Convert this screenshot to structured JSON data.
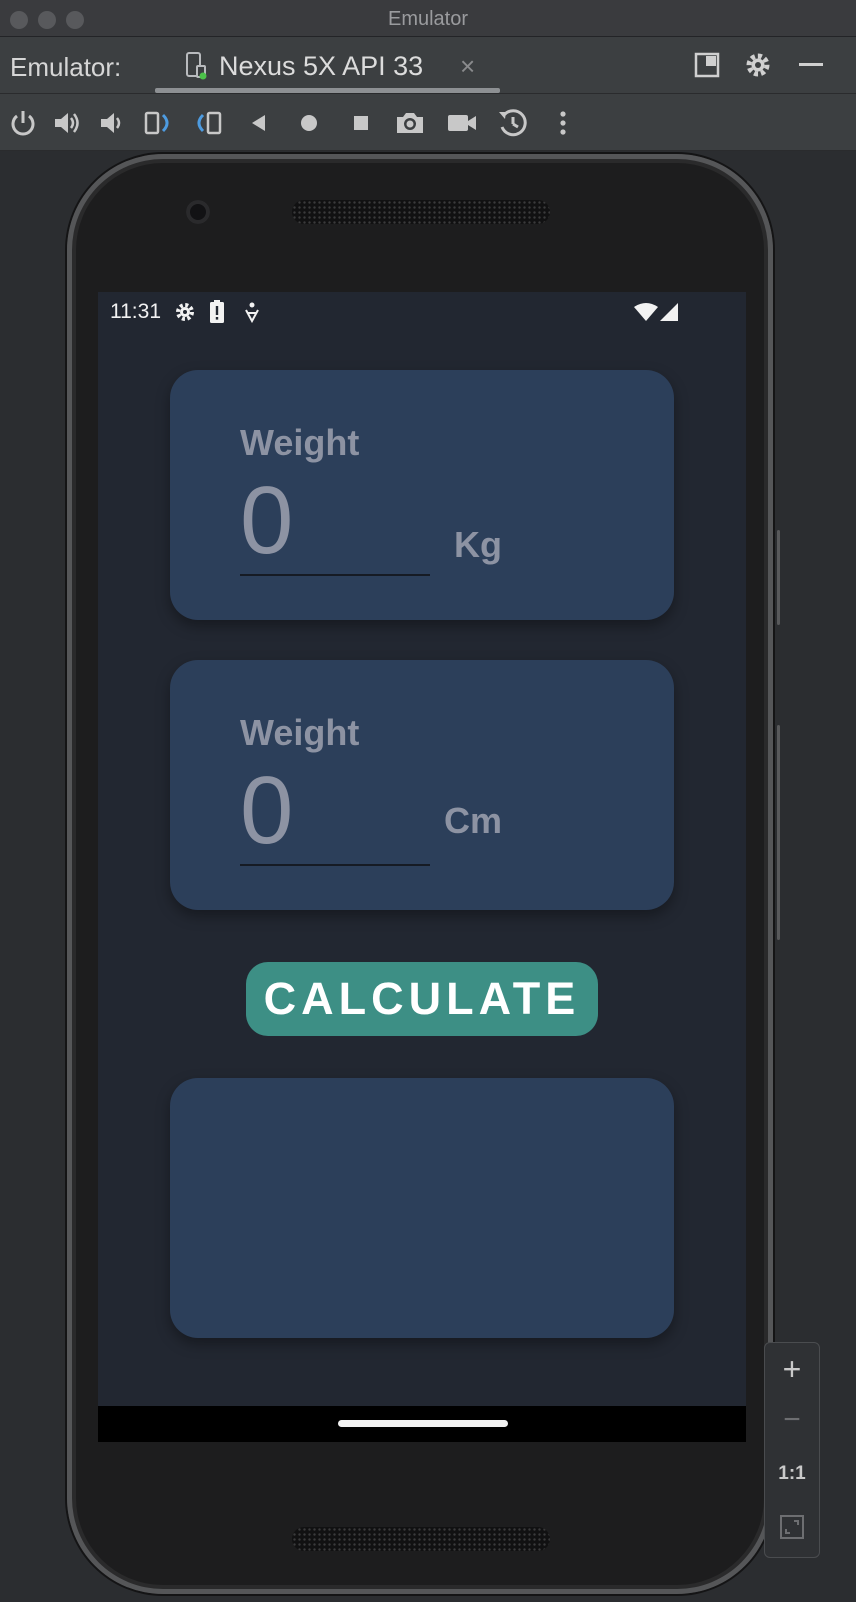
{
  "window": {
    "title": "Emulator"
  },
  "tabbar": {
    "label": "Emulator:",
    "tab_name": "Nexus 5X API 33",
    "tab_close": "×"
  },
  "toolbar": {
    "icons": [
      "power-icon",
      "volume-up-icon",
      "volume-down-icon",
      "rotate-left-icon",
      "rotate-right-icon",
      "back-icon",
      "home-icon",
      "overview-icon",
      "screenshot-icon",
      "screen-record-icon",
      "snapshots-icon",
      "more-icon"
    ]
  },
  "device": {
    "status": {
      "time": "11:31"
    },
    "weight_card": {
      "label": "Weight",
      "value": "0",
      "unit": "Kg"
    },
    "height_card": {
      "label": "Weight",
      "value": "0",
      "unit": "Cm"
    },
    "calculate_button": "CALCULATE",
    "result_card": {
      "text": ""
    }
  },
  "zoom": {
    "in": "+",
    "out": "−",
    "actual": "1:1"
  },
  "colors": {
    "screen_bg": "#222731",
    "card_bg": "#2c3f5a",
    "button_bg": "#3d8f85",
    "muted_text": "#8d93a3"
  }
}
